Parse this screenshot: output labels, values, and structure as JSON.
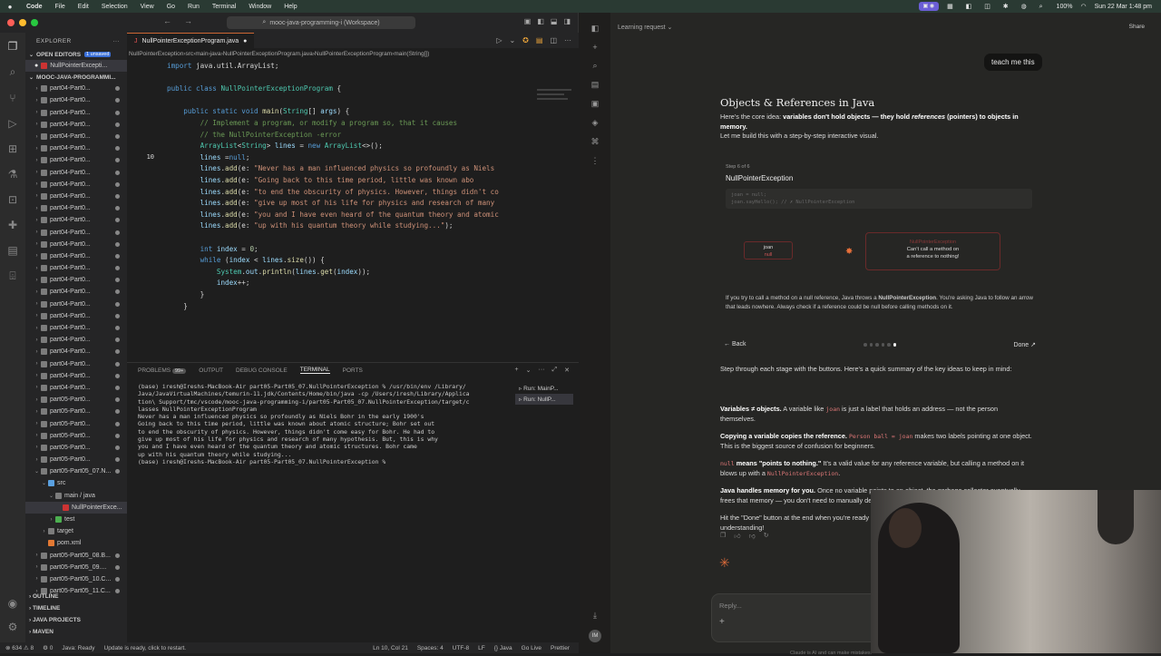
{
  "menubar": {
    "app": "Code",
    "items": [
      "File",
      "Edit",
      "Selection",
      "View",
      "Go",
      "Run",
      "Terminal",
      "Window",
      "Help"
    ],
    "datetime": "Sun 22 Mar  1:48 pm",
    "battery": "100%"
  },
  "vscode": {
    "command_center": "mooc-java-programming-i (Workspace)",
    "sidebar": {
      "title": "EXPLORER",
      "open_editors": "OPEN EDITORS",
      "unsaved": "1 unsaved",
      "open_file": "NullPointerExcepti...",
      "workspace": "MOOC-JAVA-PROGRAMMI...",
      "tree": [
        {
          "label": "part04-Part0...",
          "indent": 1,
          "chev": "›",
          "icon": "folder"
        },
        {
          "label": "part04-Part0...",
          "indent": 1,
          "chev": "›",
          "icon": "folder"
        },
        {
          "label": "part04-Part0...",
          "indent": 1,
          "chev": "›",
          "icon": "folder"
        },
        {
          "label": "part04-Part0...",
          "indent": 1,
          "chev": "›",
          "icon": "folder"
        },
        {
          "label": "part04-Part0...",
          "indent": 1,
          "chev": "›",
          "icon": "folder"
        },
        {
          "label": "part04-Part0...",
          "indent": 1,
          "chev": "›",
          "icon": "folder"
        },
        {
          "label": "part04-Part0...",
          "indent": 1,
          "chev": "›",
          "icon": "folder"
        },
        {
          "label": "part04-Part0...",
          "indent": 1,
          "chev": "›",
          "icon": "folder"
        },
        {
          "label": "part04-Part0...",
          "indent": 1,
          "chev": "›",
          "icon": "folder"
        },
        {
          "label": "part04-Part0...",
          "indent": 1,
          "chev": "›",
          "icon": "folder"
        },
        {
          "label": "part04-Part0...",
          "indent": 1,
          "chev": "›",
          "icon": "folder"
        },
        {
          "label": "part04-Part0...",
          "indent": 1,
          "chev": "›",
          "icon": "folder"
        },
        {
          "label": "part04-Part0...",
          "indent": 1,
          "chev": "›",
          "icon": "folder"
        },
        {
          "label": "part04-Part0...",
          "indent": 1,
          "chev": "›",
          "icon": "folder"
        },
        {
          "label": "part04-Part0...",
          "indent": 1,
          "chev": "›",
          "icon": "folder"
        },
        {
          "label": "part04-Part0...",
          "indent": 1,
          "chev": "›",
          "icon": "folder"
        },
        {
          "label": "part04-Part0...",
          "indent": 1,
          "chev": "›",
          "icon": "folder"
        },
        {
          "label": "part04-Part0...",
          "indent": 1,
          "chev": "›",
          "icon": "folder"
        },
        {
          "label": "part04-Part0...",
          "indent": 1,
          "chev": "›",
          "icon": "folder"
        },
        {
          "label": "part04-Part0...",
          "indent": 1,
          "chev": "›",
          "icon": "folder"
        },
        {
          "label": "part04-Part0...",
          "indent": 1,
          "chev": "›",
          "icon": "folder"
        },
        {
          "label": "part04-Part0...",
          "indent": 1,
          "chev": "›",
          "icon": "folder"
        },
        {
          "label": "part04-Part0...",
          "indent": 1,
          "chev": "›",
          "icon": "folder"
        },
        {
          "label": "part04-Part0...",
          "indent": 1,
          "chev": "›",
          "icon": "folder"
        },
        {
          "label": "part04-Part0...",
          "indent": 1,
          "chev": "›",
          "icon": "folder"
        },
        {
          "label": "part04-Part0...",
          "indent": 1,
          "chev": "›",
          "icon": "folder"
        },
        {
          "label": "part05-Part0...",
          "indent": 1,
          "chev": "›",
          "icon": "folder"
        },
        {
          "label": "part05-Part0...",
          "indent": 1,
          "chev": "›",
          "icon": "folder"
        },
        {
          "label": "part05-Part0...",
          "indent": 1,
          "chev": "›",
          "icon": "folder"
        },
        {
          "label": "part05-Part0...",
          "indent": 1,
          "chev": "›",
          "icon": "folder"
        },
        {
          "label": "part05-Part0...",
          "indent": 1,
          "chev": "›",
          "icon": "folder"
        },
        {
          "label": "part05-Part0...",
          "indent": 1,
          "chev": "›",
          "icon": "folder"
        },
        {
          "label": "part05-Part05_07.N...",
          "indent": 1,
          "chev": "⌄",
          "icon": "folder"
        },
        {
          "label": "src",
          "indent": 2,
          "chev": "⌄",
          "icon": "src"
        },
        {
          "label": "main / java",
          "indent": 3,
          "chev": "⌄",
          "icon": "folder"
        },
        {
          "label": "NullPointerExce...",
          "indent": 4,
          "chev": "",
          "icon": "java",
          "selected": true
        },
        {
          "label": "test",
          "indent": 3,
          "chev": "›",
          "icon": "test"
        },
        {
          "label": "target",
          "indent": 2,
          "chev": "›",
          "icon": "folder"
        },
        {
          "label": "pom.xml",
          "indent": 2,
          "chev": "",
          "icon": "xml"
        },
        {
          "label": "part05-Part05_08.B...",
          "indent": 1,
          "chev": "›",
          "icon": "folder"
        },
        {
          "label": "part05-Part05_09....",
          "indent": 1,
          "chev": "›",
          "icon": "folder"
        },
        {
          "label": "part05-Part05_10.C...",
          "indent": 1,
          "chev": "›",
          "icon": "folder"
        },
        {
          "label": "part05-Part05_11.C...",
          "indent": 1,
          "chev": "›",
          "icon": "folder"
        }
      ],
      "bottom_sections": [
        "OUTLINE",
        "TIMELINE",
        "JAVA PROJECTS",
        "MAVEN"
      ]
    },
    "tab": {
      "label": "NullPointerExceptionProgram.java"
    },
    "breadcrumb": [
      "NullPointerException",
      "src",
      "main",
      "java",
      "NullPointerExceptionProgram.java",
      "NullPointerExceptionProgram",
      "main(String[])"
    ],
    "code_lines": [
      {
        "n": "",
        "html": "<span class='kw'>import</span> java.util.ArrayList;"
      },
      {
        "n": "",
        "html": ""
      },
      {
        "n": "",
        "html": "<span class='kw'>public class</span> <span class='ty'>NullPointerExceptionProgram</span> {"
      },
      {
        "n": "",
        "html": ""
      },
      {
        "n": "",
        "html": "    <span class='kw'>public static void</span> <span class='fn'>main</span>(<span class='ty'>String</span>[] <span class='vr'>args</span>) {"
      },
      {
        "n": "",
        "html": "        <span class='cm'>// Implement a program, or modify a program so, that it causes</span>"
      },
      {
        "n": "",
        "html": "        <span class='cm'>// the NullPointerException -error</span>"
      },
      {
        "n": "",
        "html": "        <span class='ty'>ArrayList</span>&lt;<span class='ty'>String</span>&gt; <span class='vr'>lines</span> = <span class='kw'>new</span> <span class='ty'>ArrayList</span>&lt;&gt;();"
      },
      {
        "n": "10",
        "html": "        <span class='vr'>lines</span> =<span class='kw'>null</span>;"
      },
      {
        "n": "",
        "html": "        <span class='vr'>lines</span>.<span class='fn'>add</span>(e: <span class='st'>\"Never has a man influenced physics so profoundly as Niels</span>"
      },
      {
        "n": "",
        "html": "        <span class='vr'>lines</span>.<span class='fn'>add</span>(e: <span class='st'>\"Going back to this time period, little was known abo</span>"
      },
      {
        "n": "",
        "html": "        <span class='vr'>lines</span>.<span class='fn'>add</span>(e: <span class='st'>\"to end the obscurity of physics. However, things didn't co</span>"
      },
      {
        "n": "",
        "html": "        <span class='vr'>lines</span>.<span class='fn'>add</span>(e: <span class='st'>\"give up most of his life for physics and research of many</span>"
      },
      {
        "n": "",
        "html": "        <span class='vr'>lines</span>.<span class='fn'>add</span>(e: <span class='st'>\"you and I have even heard of the quantum theory and atomic</span>"
      },
      {
        "n": "",
        "html": "        <span class='vr'>lines</span>.<span class='fn'>add</span>(e: <span class='st'>\"up with his quantum theory while studying...\"</span>);"
      },
      {
        "n": "",
        "html": ""
      },
      {
        "n": "",
        "html": "        <span class='kw'>int</span> <span class='vr'>index</span> = <span class='nm'>0</span>;"
      },
      {
        "n": "",
        "html": "        <span class='kw'>while</span> (<span class='vr'>index</span> &lt; <span class='vr'>lines</span>.<span class='fn'>size</span>()) {"
      },
      {
        "n": "",
        "html": "            <span class='ty'>System</span>.<span class='vr'>out</span>.<span class='fn'>println</span>(<span class='vr'>lines</span>.<span class='fn'>get</span>(<span class='vr'>index</span>));"
      },
      {
        "n": "",
        "html": "            <span class='vr'>index</span>++;"
      },
      {
        "n": "",
        "html": "        }"
      },
      {
        "n": "",
        "html": "    }"
      }
    ],
    "panel_tabs": [
      "PROBLEMS",
      "OUTPUT",
      "DEBUG CONSOLE",
      "TERMINAL",
      "PORTS"
    ],
    "problems_count": "99+",
    "terminal_text": "(base) iresh@Ireshs-MacBook-Air part05-Part05_07.NullPointerException % /usr/bin/env /Library/\nJava/JavaVirtualMachines/temurin-11.jdk/Contents/Home/bin/java -cp /Users/iresh/Library/Applica\ntion\\ Support/tmc/vscode/mooc-java-programming-i/part05-Part05_07.NullPointerException/target/c\nlasses NullPointerExceptionProgram\nNever has a man influenced physics so profoundly as Niels Bohr in the early 1900's\nGoing back to this time period, little was known about atomic structure; Bohr set out\nto end the obscurity of physics. However, things didn't come easy for Bohr. He had to\ngive up most of his life for physics and research of many hypothesis. But, this is why\nyou and I have even heard of the quantum theory and atomic structures. Bohr came\nup with his quantum theory while studying...\n(base) iresh@Ireshs-MacBook-Air part05-Part05_07.NullPointerException % ",
    "run_list": [
      "Run: MainP...",
      "Run: NullP..."
    ],
    "status": {
      "left": [
        "⊗ 634 ⚠ 8",
        "⚙ 0",
        "Java: Ready",
        "Update is ready, click to restart."
      ],
      "right": [
        "Ln 10, Col 21",
        "Spaces: 4",
        "UTF-8",
        "LF",
        "{} Java",
        "Go Live",
        "Prettier"
      ]
    }
  },
  "claude": {
    "top_title": "Learning request",
    "share": "Share",
    "user_message": "teach me this",
    "title": "Objects & References in Java",
    "intro_html": "Here's the core idea: <b>variables don't hold objects — they hold <i>references</i> (pointers) to objects in memory.</b><br>Let me build this with a step-by-step interactive visual.",
    "viz": {
      "step": "Step 6 of 6",
      "title": "NullPointerException",
      "code_1": "joan = null;",
      "code_2": "joan.sayHello(); // ✗ NullPointerException",
      "joan_label": "joan",
      "joan_value": "null",
      "null_error": "NullPointerException",
      "null_msg_1": "Can't call a method on",
      "null_msg_2": "a reference to nothing!",
      "caption_html": "If you try to call a method on a <span class='code' style='color:#ccc'>null</span> reference, Java throws a <b>NullPointerException</b>. You're asking Java to follow an arrow that leads nowhere. Always check if a reference could be null before calling methods on it.",
      "back": "← Back",
      "done": "Done ↗",
      "total_steps": 6,
      "current_step": 6
    },
    "summary_intro": "Step through each stage with the buttons. Here's a quick summary of the key ideas to keep in mind:",
    "points": [
      "<b>Variables ≠ objects.</b> A variable like <span class='code'>joan</span> is just a label that holds an address — not the person themselves.",
      "<b>Copying a variable copies the reference.</b> <span class='code'>Person ball = joan</span> makes two labels pointing at one object. This is the biggest source of confusion for beginners.",
      "<span class='code'>null</span> <b>means \"points to nothing.\"</b> It's a valid value for any reference variable, but calling a method on it blows up with a <span class='code'>NullPointerException</span>.",
      "<b>Java handles memory for you.</b> Once no variable points to an object, the garbage collector eventually frees that memory — you don't need to manually delete it like in C++.",
      "Hit the \"Done\" button at the end when you're ready and I'll give you a quick question to test your understanding!"
    ],
    "reply_placeholder": "Reply...",
    "footnote": "Claude is AI and can make mistakes."
  }
}
